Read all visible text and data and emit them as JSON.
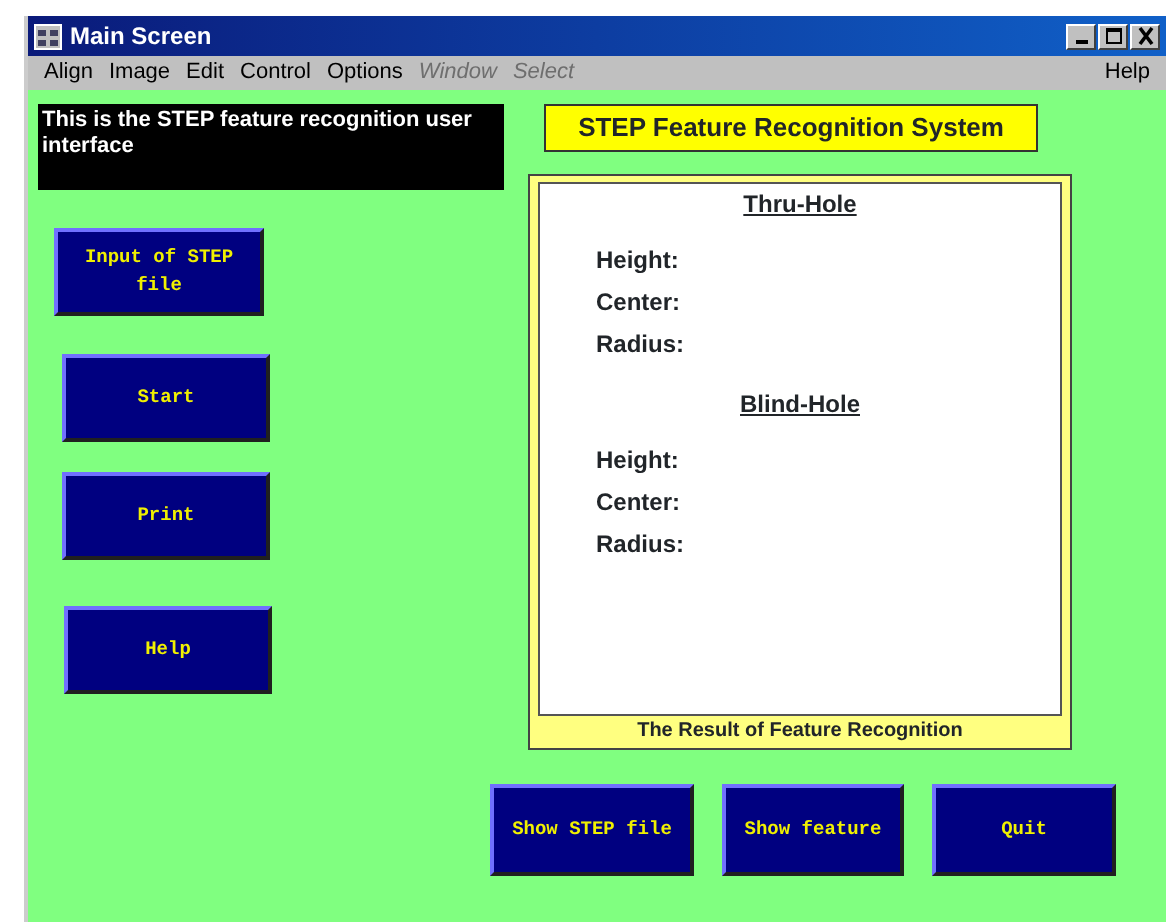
{
  "window": {
    "title": "Main Screen"
  },
  "menu": [
    {
      "label": "Align",
      "disabled": false
    },
    {
      "label": "Image",
      "disabled": false
    },
    {
      "label": "Edit",
      "disabled": false
    },
    {
      "label": "Control",
      "disabled": false
    },
    {
      "label": "Options",
      "disabled": false
    },
    {
      "label": "Window",
      "disabled": true
    },
    {
      "label": "Select",
      "disabled": true
    }
  ],
  "help_menu": {
    "label": "Help",
    "disabled": false
  },
  "info_text": "This is the STEP feature recognition user interface",
  "system_title": "STEP Feature Recognition System",
  "side_buttons": [
    "Input of STEP file",
    "Start",
    "Print",
    "Help"
  ],
  "result_panel": {
    "sections": [
      {
        "heading": "Thru-Hole",
        "fields": [
          "Height:",
          "Center:",
          "Radius:"
        ]
      },
      {
        "heading": "Blind-Hole",
        "fields": [
          "Height:",
          "Center:",
          "Radius:"
        ]
      }
    ],
    "caption": "The Result of Feature Recognition"
  },
  "bottom_buttons": [
    "Show STEP file",
    "Show feature",
    "Quit"
  ]
}
